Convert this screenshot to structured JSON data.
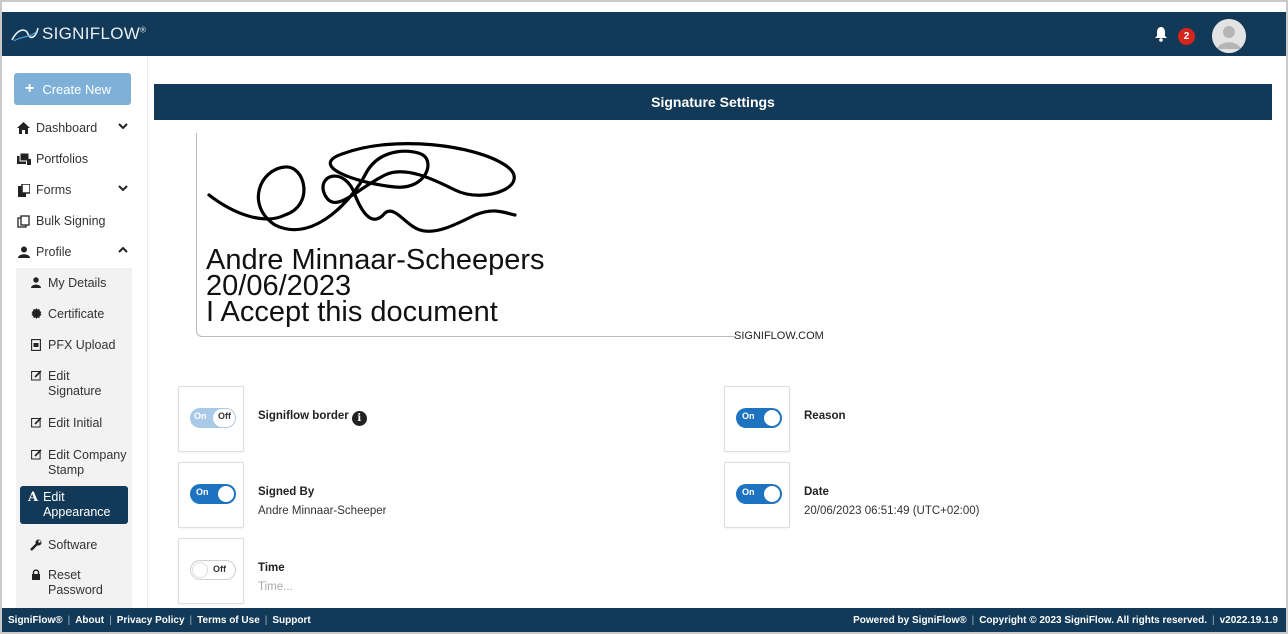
{
  "app": {
    "logo_text": "SIGNIFLOW",
    "logo_mark": "®",
    "notification_count": "2"
  },
  "sidebar": {
    "create_label": "Create New",
    "items": [
      {
        "label": "Dashboard",
        "icon": "home-icon"
      },
      {
        "label": "Portfolios",
        "icon": "portfolio-icon"
      },
      {
        "label": "Forms",
        "icon": "forms-icon"
      },
      {
        "label": "Bulk Signing",
        "icon": "bulk-signing-icon"
      },
      {
        "label": "Profile",
        "icon": "user-icon"
      }
    ],
    "profile_items": [
      {
        "label": "My Details",
        "icon": "user-icon"
      },
      {
        "label": "Certificate",
        "icon": "certificate-icon"
      },
      {
        "label": "PFX Upload",
        "icon": "file-upload-icon"
      },
      {
        "label": "Edit Signature",
        "icon": "edit-icon"
      },
      {
        "label": "Edit Initial",
        "icon": "edit-icon"
      },
      {
        "label": "Edit Company Stamp",
        "icon": "edit-icon"
      },
      {
        "label": "Edit Appearance",
        "icon": "font-icon"
      },
      {
        "label": "Software",
        "icon": "wrench-icon"
      },
      {
        "label": "Reset Password",
        "icon": "lock-icon"
      }
    ]
  },
  "main": {
    "title": "Signature Settings",
    "preview": {
      "name": "Andre Minnaar-Scheepers",
      "date": "20/06/2023",
      "reason": "I Accept this document",
      "watermark": "SIGNIFLOW.COM"
    },
    "options": {
      "border": {
        "label": "Signiflow border",
        "state_on": "On",
        "state_off": "Off"
      },
      "reason": {
        "label": "Reason",
        "state": "On"
      },
      "signed_by": {
        "label": "Signed By",
        "state": "On",
        "value": "Andre Minnaar-Scheepers"
      },
      "date": {
        "label": "Date",
        "state": "On",
        "value": "20/06/2023 06:51:49 (UTC+02:00)"
      },
      "time": {
        "label": "Time",
        "state": "Off",
        "placeholder": "Time..."
      }
    }
  },
  "footer": {
    "left": [
      "SigniFlow®",
      "About",
      "Privacy Policy",
      "Terms of Use",
      "Support"
    ],
    "right": [
      "Powered by SigniFlow®",
      "Copyright © 2023 SigniFlow. All rights reserved.",
      "v2022.19.1.9"
    ]
  },
  "colors": {
    "brand_navy": "#123a58",
    "toggle_blue": "#1d73bf",
    "create_button": "#7fb1d8",
    "badge_red": "#d6261c"
  }
}
